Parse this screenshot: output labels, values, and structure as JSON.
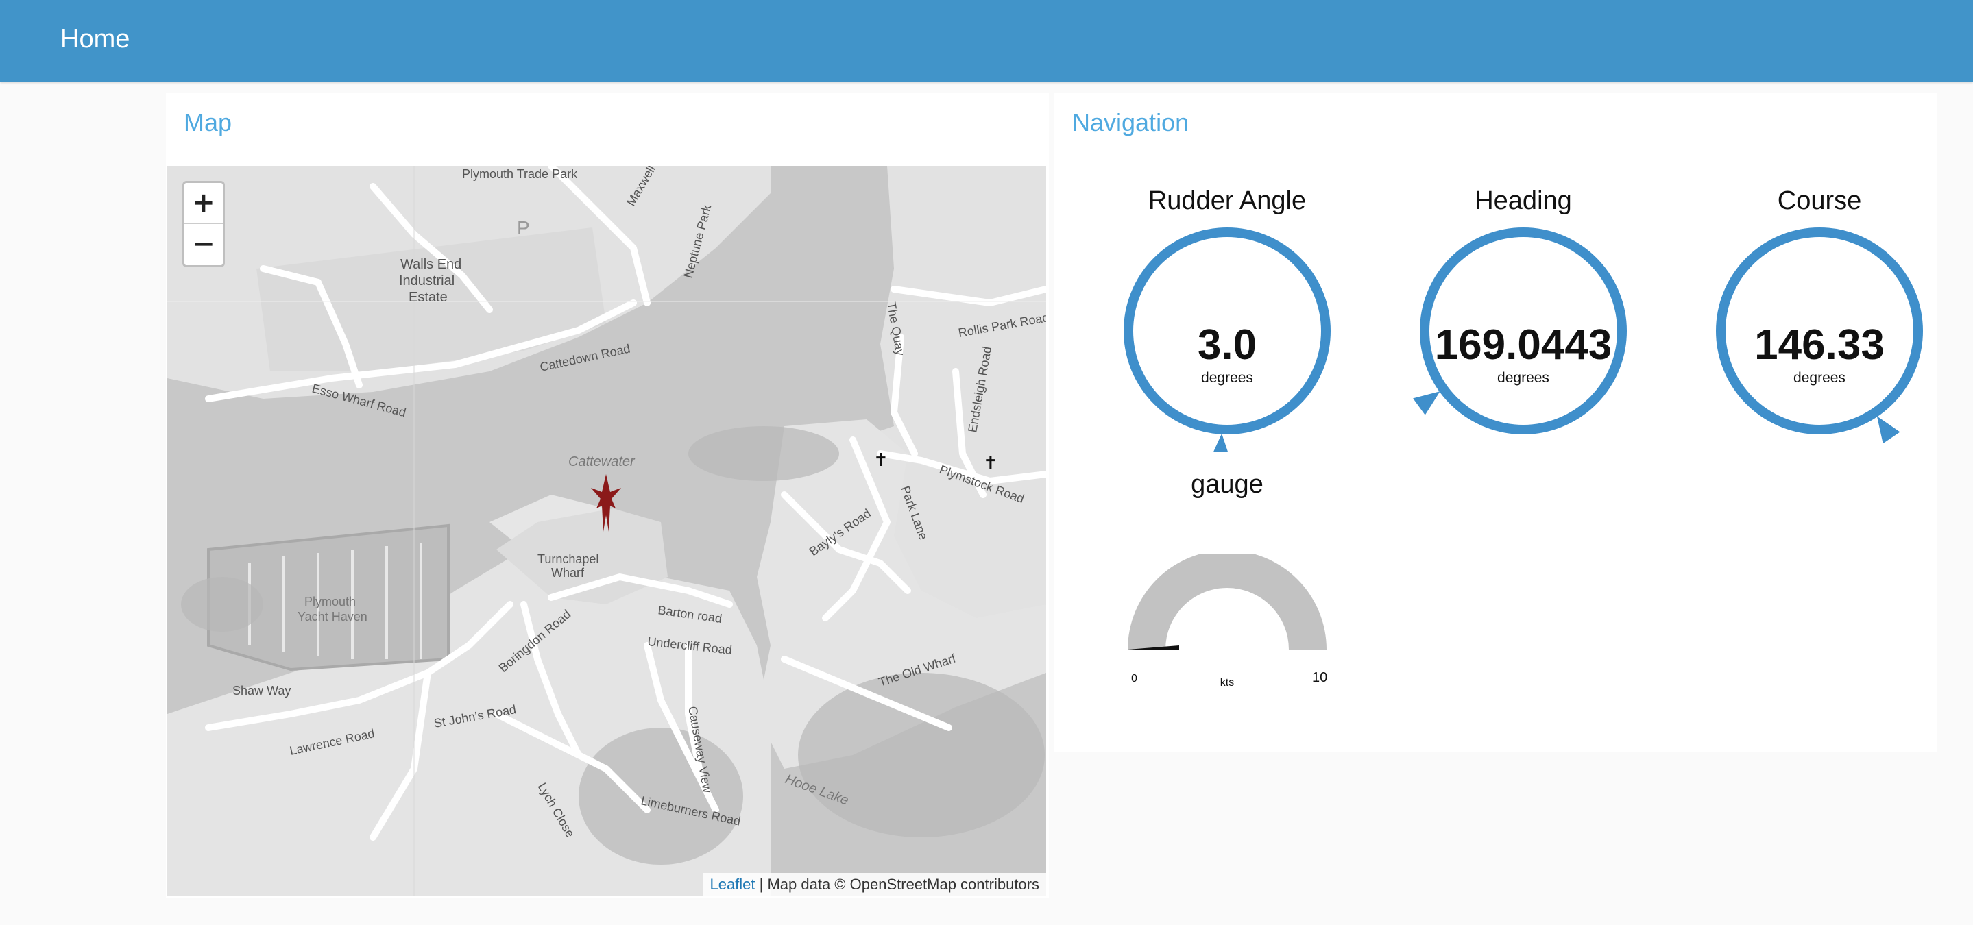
{
  "header": {
    "title": "Home"
  },
  "map_card": {
    "title": "Map",
    "zoom_in": "+",
    "zoom_out": "−",
    "attribution_link": "Leaflet",
    "attribution_text": " | Map data © OpenStreetMap contributors",
    "labels": {
      "trade_park": "Plymouth Trade Park",
      "walls_end": "Walls End",
      "industrial": "Industrial",
      "estate": "Estate",
      "cattedown_road": "Cattedown Road",
      "esso_wharf_road": "Esso Wharf Road",
      "cattewater": "Cattewater",
      "turnchapel": "Turnchapel",
      "wharf": "Wharf",
      "yacht_haven_1": "Plymouth",
      "yacht_haven_2": "Yacht Haven",
      "shaw_way": "Shaw Way",
      "lawrence_road": "Lawrence Road",
      "st_johns_road": "St John's Road",
      "boringdon_road": "Boringdon Road",
      "barton_road": "Barton road",
      "undercliff_road": "Undercliff Road",
      "causeway_view": "Causeway View",
      "limeburners_road": "Limeburners Road",
      "hooe_lake": "Hooe Lake",
      "lych_close": "Lych Close",
      "bayys_road": "Bayly's Road",
      "park_lane": "Park Lane",
      "plymstock_road": "Plymstock Road",
      "the_old_wharf": "The Old Wharf",
      "the_quay": "The Quay",
      "rollis_park_road": "Rollis Park Road",
      "endsleigh_road": "Endsleigh Road",
      "neptune_park": "Neptune Park",
      "maxwell_road": "Maxwell Road",
      "parking": "P"
    }
  },
  "nav_card": {
    "title": "Navigation",
    "rudder": {
      "title": "Rudder Angle",
      "value": "3.0",
      "unit": "degrees",
      "pointer_deg": 183
    },
    "heading": {
      "title": "Heading",
      "value": "169.0443",
      "unit": "degrees",
      "pointer_deg": 234
    },
    "course": {
      "title": "Course",
      "value": "146.33",
      "unit": "degrees",
      "pointer_deg": 146
    },
    "gauge": {
      "title": "gauge",
      "unit": "kts",
      "min": "0",
      "max": "10",
      "value": 0
    }
  },
  "colors": {
    "accent": "#4194c9",
    "title": "#4fa9e0",
    "dial": "#3f8fcb",
    "marker": "#8b1a1a"
  }
}
